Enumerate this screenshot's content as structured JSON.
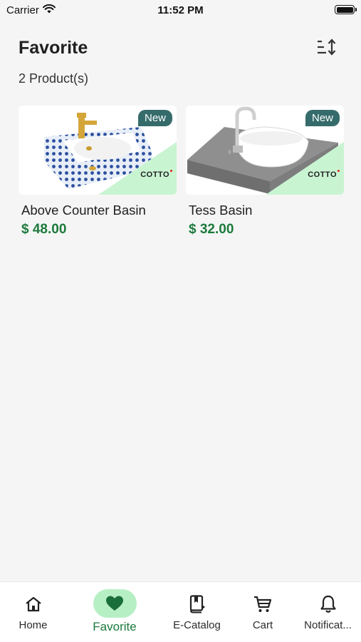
{
  "status_bar": {
    "carrier": "Carrier",
    "time": "11:52 PM"
  },
  "header": {
    "title": "Favorite",
    "product_count": "2 Product(s)",
    "sort_icon": "sort-icon"
  },
  "products": [
    {
      "badge": "New",
      "brand": "COTTO",
      "name": "Above Counter Basin",
      "price": "$ 48.00"
    },
    {
      "badge": "New",
      "brand": "COTTO",
      "name": "Tess Basin",
      "price": "$ 32.00"
    }
  ],
  "tabs": [
    {
      "label": "Home",
      "icon": "home-icon",
      "active": false
    },
    {
      "label": "Favorite",
      "icon": "heart-icon",
      "active": true
    },
    {
      "label": "E-Catalog",
      "icon": "catalog-icon",
      "active": false
    },
    {
      "label": "Cart",
      "icon": "cart-icon",
      "active": false
    },
    {
      "label": "Notificat...",
      "icon": "bell-icon",
      "active": false
    }
  ],
  "colors": {
    "accent_green": "#1c7a3c",
    "active_tab_bg": "#b7efc5",
    "badge_bg": "#366b6b",
    "background": "#f5f5f5"
  }
}
